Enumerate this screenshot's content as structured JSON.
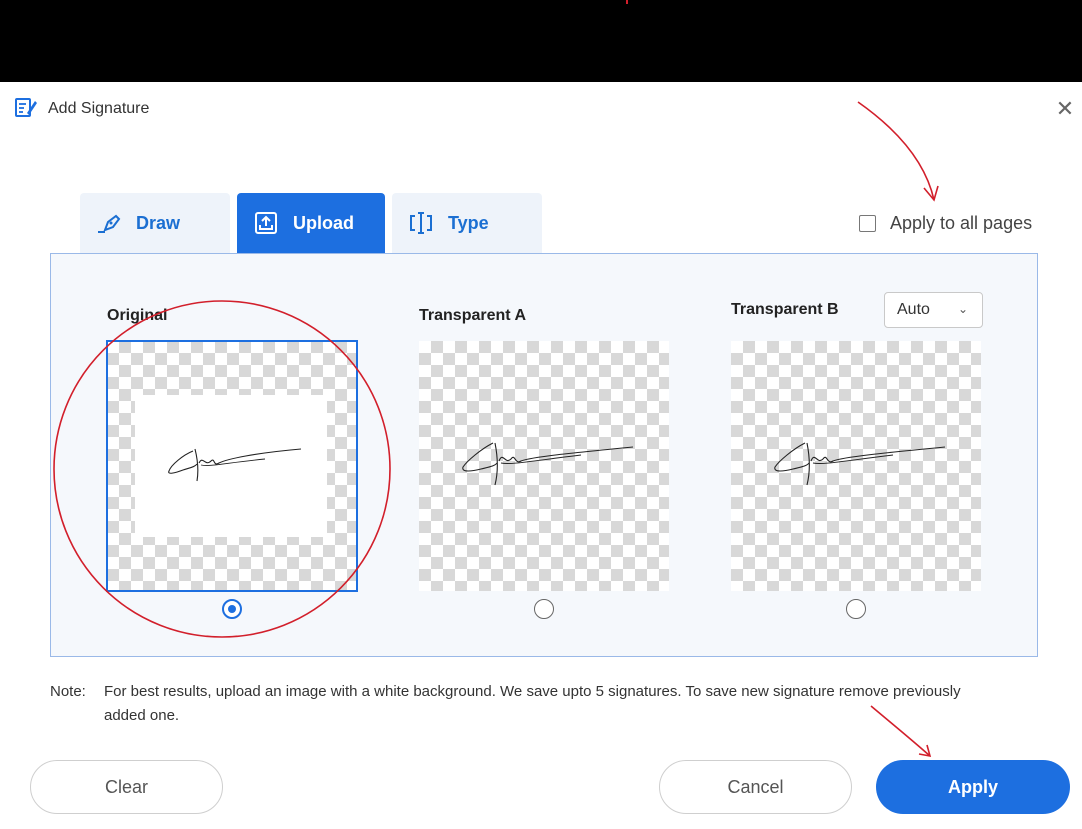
{
  "dialog": {
    "title": "Add Signature",
    "close_symbol": "✕"
  },
  "tabs": [
    {
      "label": "Draw",
      "icon": "pen-icon",
      "active": false
    },
    {
      "label": "Upload",
      "icon": "upload-icon",
      "active": true
    },
    {
      "label": "Type",
      "icon": "text-cursor-icon",
      "active": false
    }
  ],
  "apply_all": {
    "label": "Apply to all pages",
    "checked": false
  },
  "options": [
    {
      "label": "Original",
      "selected": true
    },
    {
      "label": "Transparent A",
      "selected": false
    },
    {
      "label": "Transparent B",
      "selected": false
    }
  ],
  "mode_select": {
    "value": "Auto",
    "chevron": "⌄"
  },
  "note": {
    "label": "Note:",
    "text": "For best results, upload an image with a white background. We save upto 5 signatures. To save new signature remove previously added one."
  },
  "buttons": {
    "clear": "Clear",
    "cancel": "Cancel",
    "apply": "Apply"
  },
  "colors": {
    "accent": "#1d6fe0",
    "annotation": "#d21f2b"
  }
}
